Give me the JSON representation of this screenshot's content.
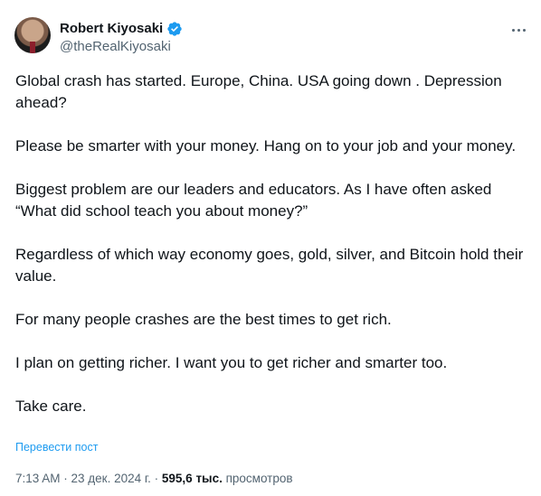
{
  "author": {
    "name": "Robert Kiyosaki",
    "handle": "@theRealKiyosaki",
    "verified": true,
    "avatar_icon": "profile-photo"
  },
  "more_icon": "more-dots-icon",
  "tweet": {
    "paragraphs": [
      "Global crash has started.  Europe, China. USA going down .  Depression ahead?",
      "Please be smarter with your money.  Hang on to your job and your money.",
      "Biggest problem are our leaders and educators.  As I have often asked “What did school teach you about money?”",
      "Regardless of which way economy goes, gold, silver, and Bitcoin hold their value.",
      "For many people crashes are the best times to get rich.",
      "I plan on getting richer.  I want you to get richer and smarter too.",
      "Take care."
    ],
    "translate_link": "Перевести пост"
  },
  "meta": {
    "time": "7:13 AM",
    "separator1": " · ",
    "date": "23 дек. 2024 г.",
    "separator2": " · ",
    "views_count": "595,6 тыс.",
    "views_label": " просмотров"
  },
  "colors": {
    "accent": "#1d9bf0",
    "text": "#0f1419",
    "muted": "#536471"
  }
}
